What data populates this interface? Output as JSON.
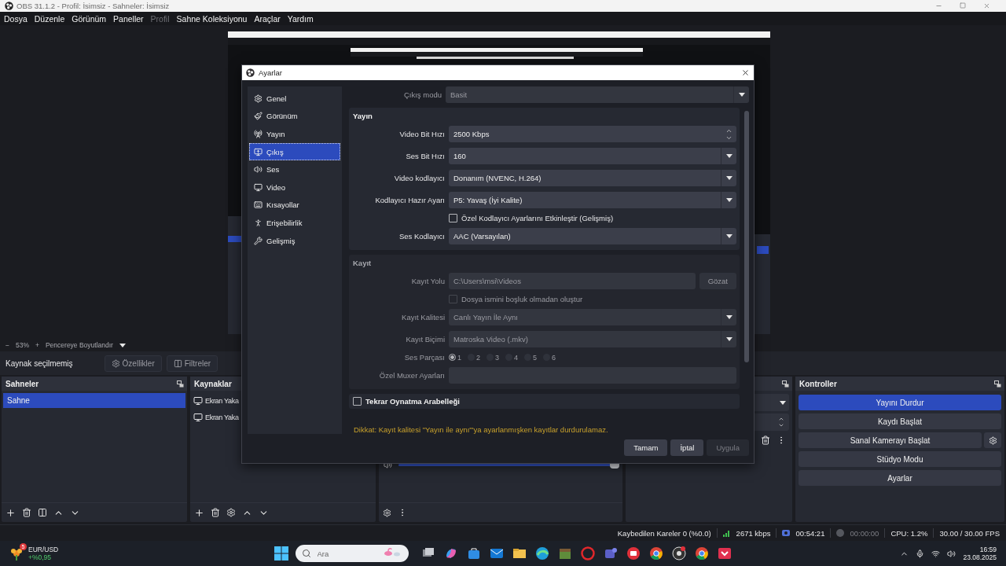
{
  "window": {
    "title": "OBS 31.1.2 - Profil: İsimsiz - Sahneler: İsimsiz"
  },
  "menu": [
    {
      "label": "Dosya",
      "disabled": false
    },
    {
      "label": "Düzenle",
      "disabled": false
    },
    {
      "label": "Görünüm",
      "disabled": false
    },
    {
      "label": "Paneller",
      "disabled": false
    },
    {
      "label": "Profil",
      "disabled": true
    },
    {
      "label": "Sahne Koleksiyonu",
      "disabled": false
    },
    {
      "label": "Araçlar",
      "disabled": false
    },
    {
      "label": "Yardım",
      "disabled": false
    }
  ],
  "preview_toolbar": {
    "zoom_out": "−",
    "zoom": "53%",
    "zoom_in": "+",
    "fit": "Pencereye Boyutlandır"
  },
  "source_toolbar": {
    "status": "Kaynak seçilmemiş",
    "buttons": [
      "Özellikler",
      "Filtreler"
    ]
  },
  "scenes": {
    "title": "Sahneler",
    "items": [
      {
        "label": "Sahne",
        "selected": true
      }
    ]
  },
  "sources": {
    "items": [
      {
        "label": "Ekran Yaka"
      },
      {
        "label": "Ekran Yaka"
      }
    ],
    "title": "Kaynaklar"
  },
  "mixer": {
    "level": 1
  },
  "controls": {
    "title": "Kontroller",
    "buttons": [
      {
        "label": "Yayını Durdur",
        "checked": true,
        "kind": "plain"
      },
      {
        "label": "Kaydı Başlat",
        "checked": false,
        "kind": "plain"
      },
      {
        "label": "Sanal Kamerayı Başlat",
        "checked": false,
        "kind": "with-settings"
      },
      {
        "label": "Stüdyo Modu",
        "checked": false,
        "kind": "plain"
      },
      {
        "label": "Ayarlar",
        "checked": false,
        "kind": "plain"
      }
    ]
  },
  "status_bar": {
    "dropped_frames": "Kaybedilen Kareler 0 (%0.0)",
    "bitrate": "2671 kbps",
    "stream_time": "00:54:21",
    "record_time": "00:00:00",
    "cpu": "CPU: 1.2%",
    "fps": "30.00 / 30.00 FPS"
  },
  "taskbar": {
    "widget": {
      "badge": "5",
      "symbol": "EUR/USD",
      "change": "+%0,95"
    },
    "search": {
      "placeholder": "Ara"
    },
    "clock": {
      "time": "16:59",
      "date": "23.08.2025"
    }
  },
  "dialog": {
    "title": "Ayarlar",
    "nav": [
      {
        "label": "Genel",
        "selected": false
      },
      {
        "label": "Görünüm",
        "selected": false
      },
      {
        "label": "Yayın",
        "selected": false
      },
      {
        "label": "Çıkış",
        "selected": true
      },
      {
        "label": "Ses",
        "selected": false
      },
      {
        "label": "Video",
        "selected": false
      },
      {
        "label": "Kısayollar",
        "selected": false
      },
      {
        "label": "Erişebilirlik",
        "selected": false
      },
      {
        "label": "Gelişmiş",
        "selected": false
      }
    ],
    "output_mode": {
      "label": "Çıkış modu",
      "value": "Basit"
    },
    "groups": [
      {
        "title": "Yayın",
        "disabled": false,
        "rows": [
          {
            "kind": "spin",
            "label": "Video Bit Hızı",
            "value": "2500 Kbps"
          },
          {
            "kind": "select",
            "label": "Ses Bit Hızı",
            "value": "160"
          },
          {
            "kind": "select",
            "label": "Video kodlayıcı",
            "value": "Donanım (NVENC, H.264)"
          },
          {
            "kind": "select",
            "label": "Kodlayıcı Hazır Ayarı",
            "value": "P5: Yavaş (İyi Kalite)"
          },
          {
            "kind": "checkbox",
            "label": "Özel Kodlayıcı Ayarlarını Etkinleştir (Gelişmiş)",
            "checked": false
          },
          {
            "kind": "select",
            "label": "Ses Kodlayıcı",
            "value": "AAC (Varsayılan)"
          }
        ]
      },
      {
        "title": "Kayıt",
        "disabled": true,
        "rows": [
          {
            "kind": "path",
            "label": "Kayıt Yolu",
            "value": "C:\\Users\\msi\\Videos",
            "button": "Gözat"
          },
          {
            "kind": "checkbox",
            "label": "Dosya ismini boşluk olmadan oluştur",
            "checked": false
          },
          {
            "kind": "select",
            "label": "Kayıt Kalitesi",
            "value": "Canlı Yayın İle Aynı"
          },
          {
            "kind": "select",
            "label": "Kayıt Biçimi",
            "value": "Matroska Video (.mkv)"
          },
          {
            "kind": "tracks",
            "label": "Ses Parçası",
            "tracks": [
              {
                "label": "1",
                "selected": true
              },
              {
                "label": "2",
                "selected": false
              },
              {
                "label": "3",
                "selected": false
              },
              {
                "label": "4",
                "selected": false
              },
              {
                "label": "5",
                "selected": false
              },
              {
                "label": "6",
                "selected": false
              }
            ]
          },
          {
            "kind": "text",
            "label": "Özel Muxer Ayarları"
          }
        ]
      }
    ],
    "replay_buffer": {
      "label": "Tekrar Oynatma Arabelleği",
      "checked": false
    },
    "warning": "Dikkat: Kayıt kalitesi \"Yayın ile aynı\"'ya ayarlanmışken kayıtlar durdurulamaz.",
    "buttons": [
      {
        "label": "Tamam",
        "disabled": false
      },
      {
        "label": "İptal",
        "disabled": false
      },
      {
        "label": "Uygula",
        "disabled": true
      }
    ]
  }
}
